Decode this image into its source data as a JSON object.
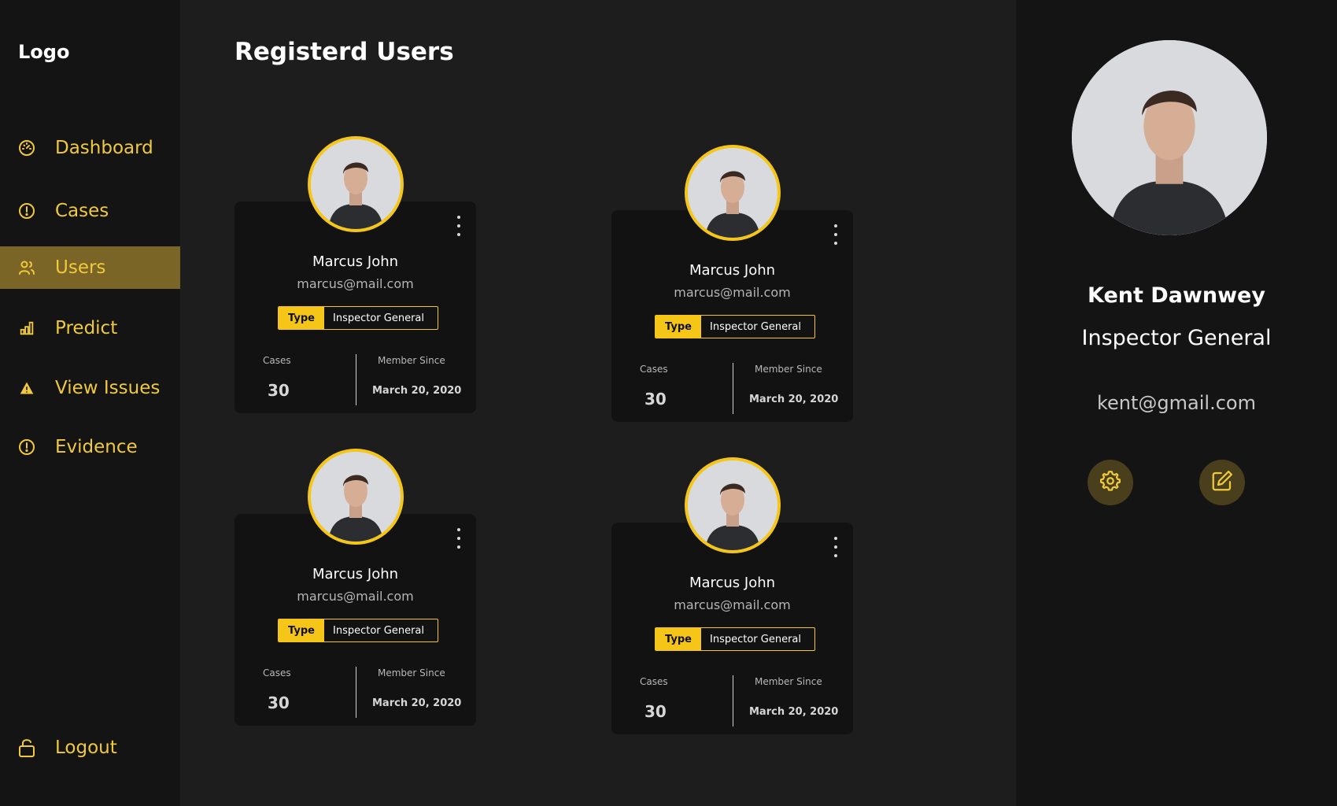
{
  "app": {
    "logo": "Logo",
    "accent_color": "#f5c518",
    "active_nav_color": "#7a6526"
  },
  "sidebar": {
    "items": [
      {
        "label": "Dashboard",
        "icon": "dashboard-gauge-icon"
      },
      {
        "label": "Cases",
        "icon": "alert-circle-icon"
      },
      {
        "label": "Users",
        "icon": "users-icon",
        "active": true
      },
      {
        "label": "Predict",
        "icon": "bar-chart-icon"
      },
      {
        "label": "View Issues",
        "icon": "warning-triangle-icon"
      },
      {
        "label": "Evidence",
        "icon": "alert-circle-icon"
      }
    ],
    "logout": {
      "label": "Logout",
      "icon": "unlock-icon"
    }
  },
  "main": {
    "title": "Registerd Users",
    "cards": [
      {
        "name": "Marcus John",
        "email": "marcus@mail.com",
        "type_label": "Type",
        "type_value": "Inspector General",
        "cases_label": "Cases",
        "cases": "30",
        "since_label": "Member Since",
        "since": "March 20, 2020"
      },
      {
        "name": "Marcus John",
        "email": "marcus@mail.com",
        "type_label": "Type",
        "type_value": "Inspector General",
        "cases_label": "Cases",
        "cases": "30",
        "since_label": "Member Since",
        "since": "March 20, 2020"
      },
      {
        "name": "Marcus John",
        "email": "marcus@mail.com",
        "type_label": "Type",
        "type_value": "Inspector General",
        "cases_label": "Cases",
        "cases": "30",
        "since_label": "Member Since",
        "since": "March 20, 2020"
      },
      {
        "name": "Marcus John",
        "email": "marcus@mail.com",
        "type_label": "Type",
        "type_value": "Inspector General",
        "cases_label": "Cases",
        "cases": "30",
        "since_label": "Member Since",
        "since": "March 20, 2020"
      }
    ]
  },
  "profile": {
    "name": "Kent Dawnwey",
    "role": "Inspector General",
    "email": "kent@gmail.com",
    "actions": [
      {
        "icon": "settings-gear-icon"
      },
      {
        "icon": "edit-icon"
      }
    ]
  }
}
